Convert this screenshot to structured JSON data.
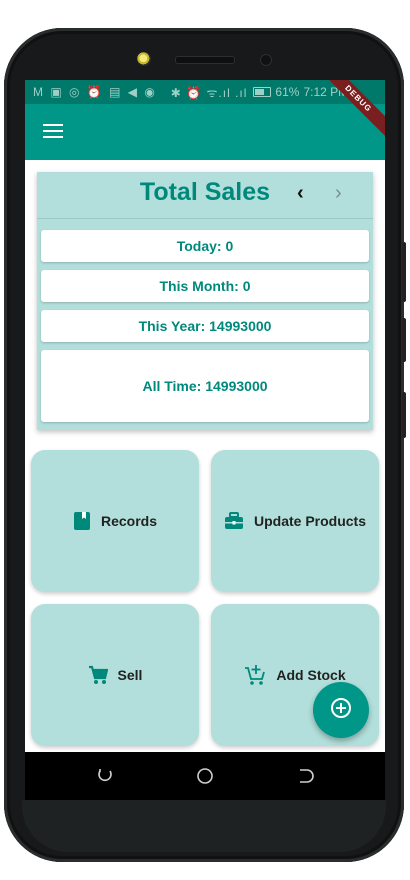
{
  "status_bar": {
    "left_icons": "M ▣ ◎ ⏰ ▤ ◀ ◉",
    "right_icons": "✱ ⏰ ᯤ.ıl .ıl",
    "battery": "61%",
    "time": "7:12 PM"
  },
  "debug_banner": "DEBUG",
  "colors": {
    "primary": "#009688",
    "primary_dark": "#00796b",
    "tile_background": "#b2dfdb",
    "accent_text": "#00897b"
  },
  "sales_card": {
    "title": "Total Sales",
    "prev_label": "‹",
    "next_label": "›",
    "stats": [
      {
        "label": "Today: 0"
      },
      {
        "label": "This Month: 0"
      },
      {
        "label": "This Year: 14993000"
      },
      {
        "label": "All Time: 14993000"
      }
    ]
  },
  "tiles": [
    {
      "label": "Records",
      "icon": "book-icon"
    },
    {
      "label": "Update Products",
      "icon": "briefcase-icon"
    },
    {
      "label": "Sell",
      "icon": "shopping-cart-icon"
    },
    {
      "label": "Add Stock",
      "icon": "add-shopping-cart-icon"
    }
  ],
  "fab_icon": "add-circle-icon",
  "nav_keys": [
    "recent-apps-icon",
    "home-icon",
    "back-icon"
  ]
}
